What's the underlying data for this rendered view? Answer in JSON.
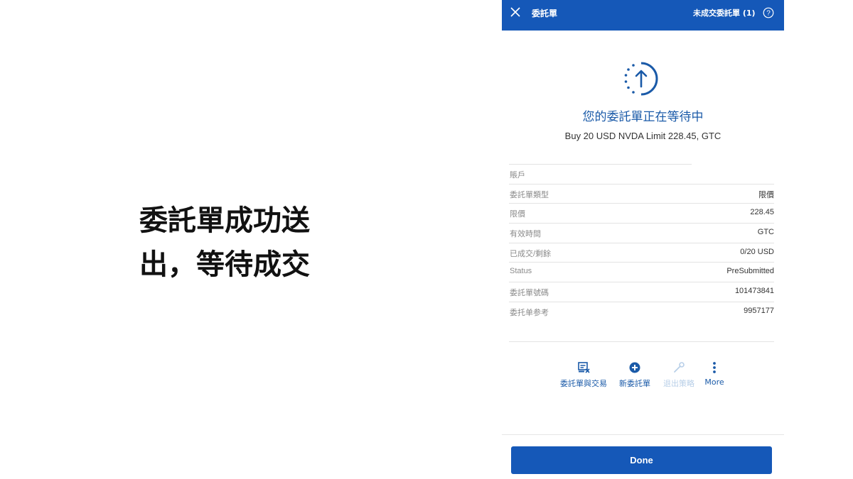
{
  "caption": {
    "line1": "委託單成功送",
    "line2": "出，等待成交"
  },
  "topbar": {
    "title": "委託單",
    "pending_orders": "未成交委託單 (1)"
  },
  "status": {
    "title": "您的委託單正在等待中",
    "summary": "Buy 20 USD NVDA Limit 228.45, GTC"
  },
  "details": [
    {
      "label": "賬戶",
      "value": ""
    },
    {
      "label": "委託單類型",
      "value": "限價"
    },
    {
      "label": "限價",
      "value": "228.45"
    },
    {
      "label": "有效時間",
      "value": "GTC"
    },
    {
      "label": "已成交/剩餘",
      "value": "0/20 USD"
    },
    {
      "label": "Status",
      "value": "PreSubmitted"
    },
    {
      "label": "委託單號碼",
      "value": "101473841"
    },
    {
      "label": "委托单参考",
      "value": "9957177"
    }
  ],
  "actions": {
    "orders_trades": "委託單與交易",
    "new_order": "新委託單",
    "exit_strategy": "退出策略",
    "more": "More"
  },
  "done_label": "Done",
  "colors": {
    "brand": "#1558b8",
    "accent_text": "#1a5aa8",
    "disabled": "#b8cfe8"
  },
  "icons": [
    "close-icon",
    "help-icon",
    "upload-status-icon",
    "orders-trades-icon",
    "plus-circle-icon",
    "wrench-icon",
    "more-vertical-icon"
  ]
}
